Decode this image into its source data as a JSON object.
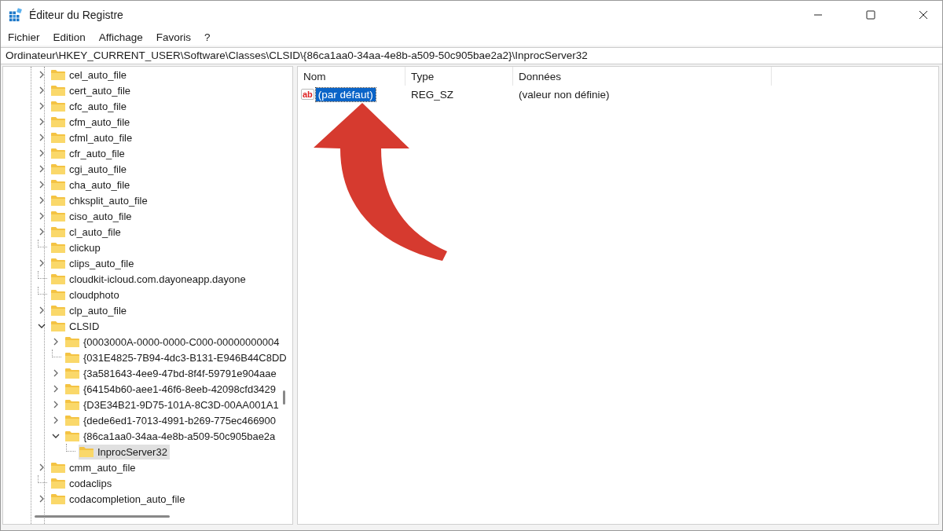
{
  "window": {
    "title": "Éditeur du Registre"
  },
  "menu": [
    {
      "label": "Fichier"
    },
    {
      "label": "Edition"
    },
    {
      "label": "Affichage"
    },
    {
      "label": "Favoris"
    },
    {
      "label": "?"
    }
  ],
  "address": "Ordinateur\\HKEY_CURRENT_USER\\Software\\Classes\\CLSID\\{86ca1aa0-34aa-4e8b-a509-50c905bae2a2}\\InprocServer32",
  "tree": [
    {
      "label": "cel_auto_file",
      "has_children": true,
      "expanded": false,
      "selected": false
    },
    {
      "label": "cert_auto_file",
      "has_children": true,
      "expanded": false,
      "selected": false
    },
    {
      "label": "cfc_auto_file",
      "has_children": true,
      "expanded": false,
      "selected": false
    },
    {
      "label": "cfm_auto_file",
      "has_children": true,
      "expanded": false,
      "selected": false
    },
    {
      "label": "cfml_auto_file",
      "has_children": true,
      "expanded": false,
      "selected": false
    },
    {
      "label": "cfr_auto_file",
      "has_children": true,
      "expanded": false,
      "selected": false
    },
    {
      "label": "cgi_auto_file",
      "has_children": true,
      "expanded": false,
      "selected": false
    },
    {
      "label": "cha_auto_file",
      "has_children": true,
      "expanded": false,
      "selected": false
    },
    {
      "label": "chksplit_auto_file",
      "has_children": true,
      "expanded": false,
      "selected": false
    },
    {
      "label": "ciso_auto_file",
      "has_children": true,
      "expanded": false,
      "selected": false
    },
    {
      "label": "cl_auto_file",
      "has_children": true,
      "expanded": false,
      "selected": false
    },
    {
      "label": "clickup",
      "has_children": false,
      "selected": false
    },
    {
      "label": "clips_auto_file",
      "has_children": true,
      "expanded": false,
      "selected": false
    },
    {
      "label": "cloudkit-icloud.com.dayoneapp.dayone",
      "has_children": false,
      "selected": false
    },
    {
      "label": "cloudphoto",
      "has_children": false,
      "selected": false
    },
    {
      "label": "clp_auto_file",
      "has_children": true,
      "expanded": false,
      "selected": false
    },
    {
      "label": "CLSID",
      "has_children": true,
      "expanded": true,
      "selected": false,
      "children": [
        {
          "label": "{0003000A-0000-0000-C000-00000000004",
          "has_children": true,
          "expanded": false,
          "selected": false
        },
        {
          "label": "{031E4825-7B94-4dc3-B131-E946B44C8DD",
          "has_children": false,
          "selected": false
        },
        {
          "label": "{3a581643-4ee9-47bd-8f4f-59791e904aae",
          "has_children": true,
          "expanded": false,
          "selected": false
        },
        {
          "label": "{64154b60-aee1-46f6-8eeb-42098cfd3429",
          "has_children": true,
          "expanded": false,
          "selected": false
        },
        {
          "label": "{D3E34B21-9D75-101A-8C3D-00AA001A1",
          "has_children": true,
          "expanded": false,
          "selected": false
        },
        {
          "label": "{dede6ed1-7013-4991-b269-775ec466900",
          "has_children": true,
          "expanded": false,
          "selected": false
        },
        {
          "label": "{86ca1aa0-34aa-4e8b-a509-50c905bae2a",
          "has_children": true,
          "expanded": true,
          "selected": false,
          "children": [
            {
              "label": "InprocServer32",
              "has_children": false,
              "selected": true
            }
          ]
        }
      ]
    },
    {
      "label": "cmm_auto_file",
      "has_children": true,
      "expanded": false,
      "selected": false
    },
    {
      "label": "codaclips",
      "has_children": false,
      "selected": false
    },
    {
      "label": "codacompletion_auto_file",
      "has_children": true,
      "expanded": false,
      "selected": false
    }
  ],
  "values": {
    "columns": [
      "Nom",
      "Type",
      "Données"
    ],
    "rows": [
      {
        "icon_text": "ab",
        "name": "(par défaut)",
        "type": "REG_SZ",
        "data": "(valeur non définie)",
        "selected": true
      }
    ]
  },
  "annotation": {
    "kind": "arrow"
  }
}
